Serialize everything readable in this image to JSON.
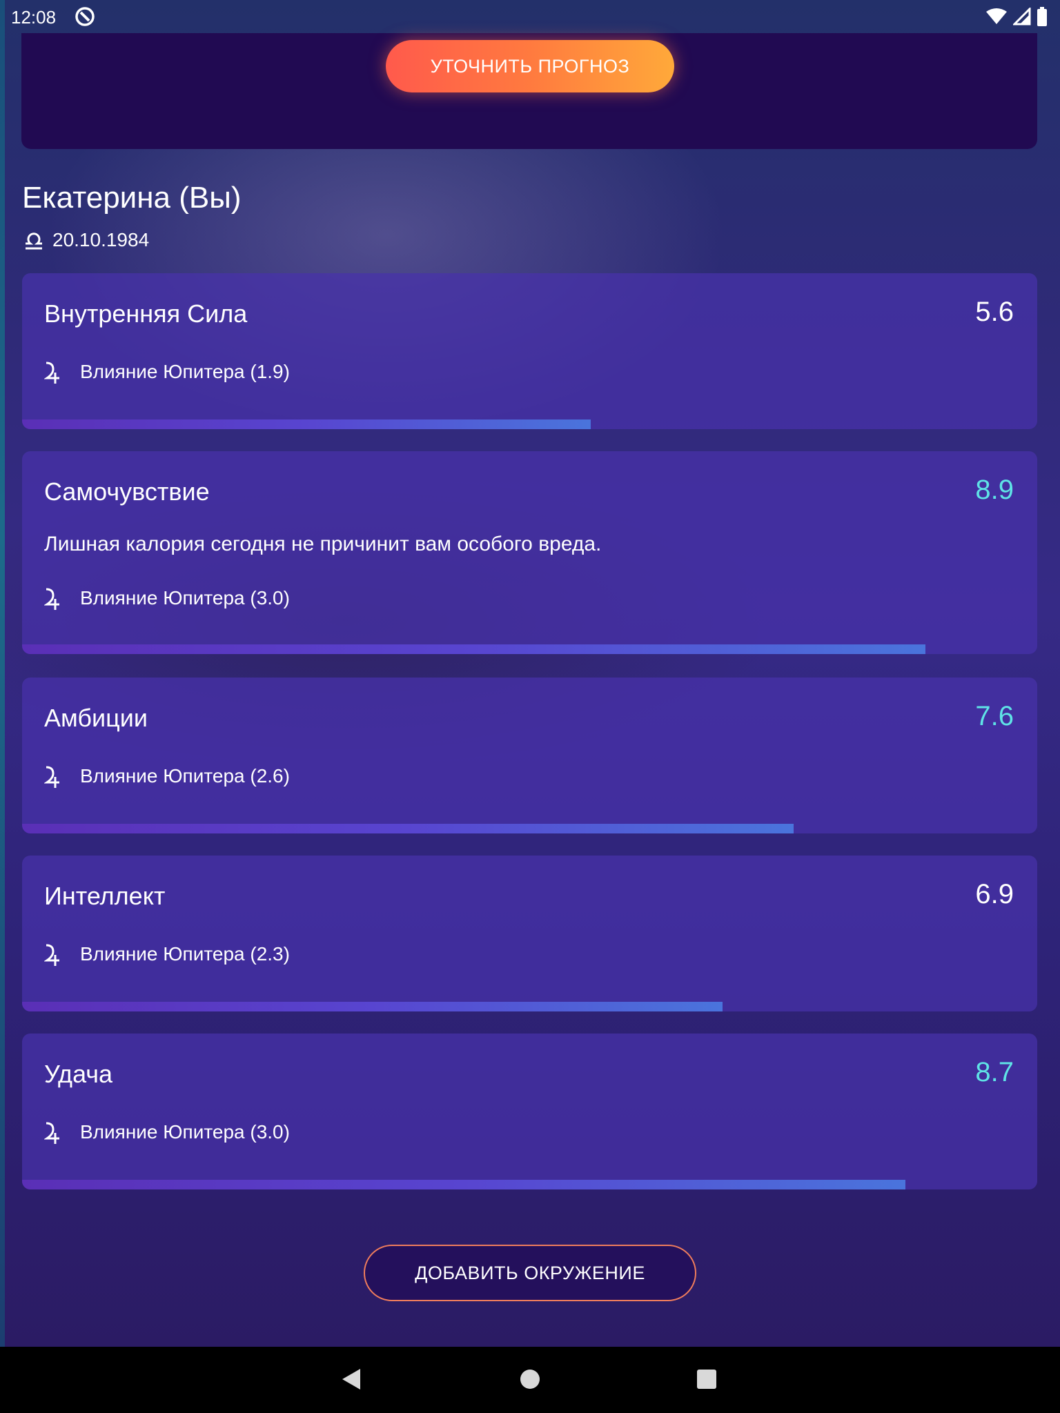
{
  "status_bar": {
    "time": "12:08",
    "icons": [
      "app-notification-icon",
      "wifi-icon",
      "signal-icon",
      "battery-icon"
    ]
  },
  "top_card": {
    "refine_button_label": "УТОЧНИТЬ ПРОГНОЗ"
  },
  "profile": {
    "name": "Екатерина (Вы)",
    "zodiac_icon": "libra-icon",
    "birth_date": "20.10.1984"
  },
  "cards": [
    {
      "title": "Внутренняя Сила",
      "score": "5.6",
      "score_color": "#ffffff",
      "text": "",
      "influence_icon": "jupiter-icon",
      "influence": "Влияние Юпитера (1.9)",
      "progress": 0.56
    },
    {
      "title": "Самочувствие",
      "score": "8.9",
      "score_color": "#5fe3e6",
      "text": "Лишная калория сегодня не причинит вам особого вреда.",
      "influence_icon": "jupiter-icon",
      "influence": "Влияние Юпитера (3.0)",
      "progress": 0.89
    },
    {
      "title": "Амбиции",
      "score": "7.6",
      "score_color": "#5fe3e6",
      "text": "",
      "influence_icon": "jupiter-icon",
      "influence": "Влияние Юпитера (2.6)",
      "progress": 0.76
    },
    {
      "title": "Интеллект",
      "score": "6.9",
      "score_color": "#ffffff",
      "text": "",
      "influence_icon": "jupiter-icon",
      "influence": "Влияние Юпитера (2.3)",
      "progress": 0.69
    },
    {
      "title": "Удача",
      "score": "8.7",
      "score_color": "#5fe3e6",
      "text": "",
      "influence_icon": "jupiter-icon",
      "influence": "Влияние Юпитера (3.0)",
      "progress": 0.87
    }
  ],
  "add_button_label": "ДОБАВИТЬ ОКРУЖЕНИЕ",
  "nav_bar": {
    "icons": [
      "back-icon",
      "home-icon",
      "recents-icon"
    ]
  }
}
